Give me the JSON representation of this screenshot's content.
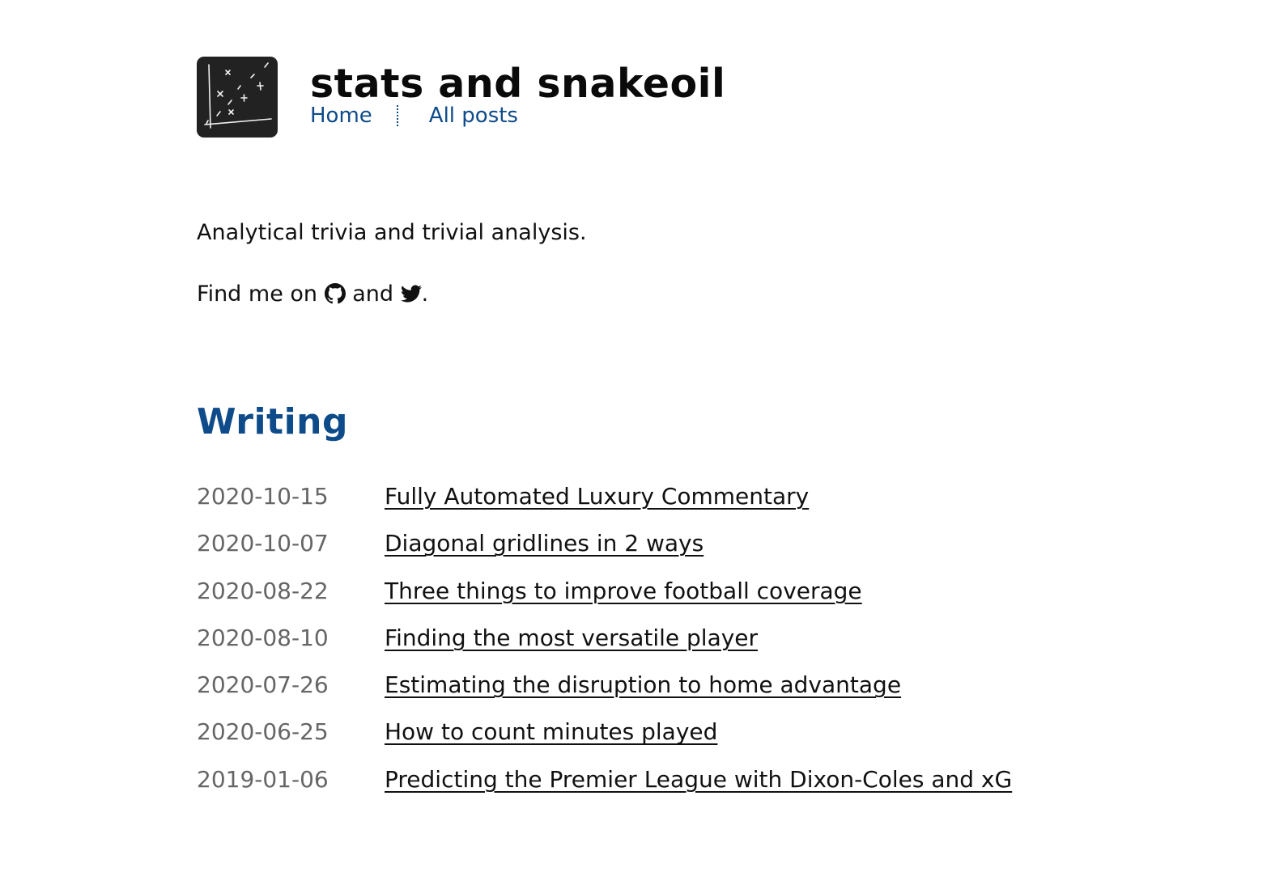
{
  "site": {
    "title": "stats and snakeoil",
    "logo_icon": "scatter-plot-chalk-icon"
  },
  "nav": {
    "items": [
      {
        "label": "Home"
      },
      {
        "label": "All posts"
      }
    ]
  },
  "intro": {
    "tagline": "Analytical trivia and trivial analysis.",
    "find_prefix": "Find me on",
    "find_and": "and",
    "find_suffix": ".",
    "icons": [
      "github-icon",
      "twitter-icon"
    ]
  },
  "writing": {
    "heading": "Writing",
    "posts": [
      {
        "date": "2020-10-15",
        "title": "Fully Automated Luxury Commentary"
      },
      {
        "date": "2020-10-07",
        "title": "Diagonal gridlines in 2 ways"
      },
      {
        "date": "2020-08-22",
        "title": "Three things to improve football coverage"
      },
      {
        "date": "2020-08-10",
        "title": "Finding the most versatile player"
      },
      {
        "date": "2020-07-26",
        "title": "Estimating the disruption to home advantage"
      },
      {
        "date": "2020-06-25",
        "title": "How to count minutes played"
      },
      {
        "date": "2019-01-06",
        "title": "Predicting the Premier League with Dixon-Coles and xG"
      }
    ]
  },
  "colors": {
    "link_blue": "#0e4b8a",
    "date_gray": "#666666",
    "logo_bg": "#222222"
  }
}
